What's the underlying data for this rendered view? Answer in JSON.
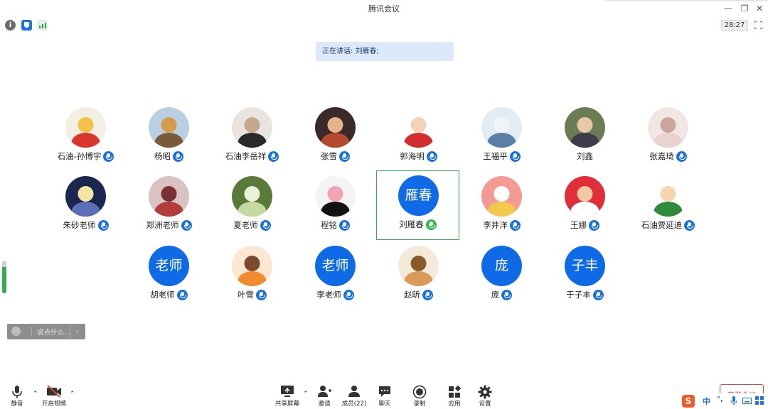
{
  "window": {
    "title": "腾讯会议"
  },
  "toolbar": {
    "timer": "28:27"
  },
  "banner": {
    "speaking": "正在讲话: 刘雁春;"
  },
  "participants": [
    {
      "name": "石油-孙博宇",
      "initials": "",
      "avatar": "photo",
      "mic": "on"
    },
    {
      "name": "杨昭",
      "initials": "",
      "avatar": "photo",
      "mic": "on"
    },
    {
      "name": "石油李岳祥",
      "initials": "",
      "avatar": "photo",
      "mic": "on"
    },
    {
      "name": "张雪",
      "initials": "",
      "avatar": "photo",
      "mic": "on"
    },
    {
      "name": "郭海明",
      "initials": "",
      "avatar": "photo",
      "mic": "on"
    },
    {
      "name": "王福平",
      "initials": "",
      "avatar": "photo",
      "mic": "on"
    },
    {
      "name": "刘鑫",
      "initials": "",
      "avatar": "photo",
      "mic": "none"
    },
    {
      "name": "张嘉琦",
      "initials": "",
      "avatar": "photo",
      "mic": "on"
    },
    {
      "name": "朱砂老师",
      "initials": "",
      "avatar": "photo",
      "mic": "on"
    },
    {
      "name": "郑洲老师",
      "initials": "",
      "avatar": "photo",
      "mic": "on"
    },
    {
      "name": "夏老师",
      "initials": "",
      "avatar": "photo",
      "mic": "on"
    },
    {
      "name": "程铭",
      "initials": "",
      "avatar": "photo",
      "mic": "on"
    },
    {
      "name": "刘雁春",
      "initials": "雁春",
      "avatar": "initials",
      "mic": "talking",
      "active": true
    },
    {
      "name": "李井洋",
      "initials": "",
      "avatar": "photo",
      "mic": "on"
    },
    {
      "name": "王娜",
      "initials": "",
      "avatar": "photo",
      "mic": "on"
    },
    {
      "name": "石油贾延迪",
      "initials": "",
      "avatar": "photo",
      "mic": "on"
    },
    {
      "name": "胡老师",
      "initials": "老师",
      "avatar": "initials",
      "mic": "on"
    },
    {
      "name": "叶雪",
      "initials": "",
      "avatar": "photo",
      "mic": "on"
    },
    {
      "name": "李老师",
      "initials": "老师",
      "avatar": "initials",
      "mic": "on"
    },
    {
      "name": "赵昕",
      "initials": "",
      "avatar": "photo",
      "mic": "on"
    },
    {
      "name": "庞",
      "initials": "庞",
      "avatar": "initials",
      "mic": "on"
    },
    {
      "name": "于子丰",
      "initials": "子丰",
      "avatar": "initials",
      "mic": "on"
    }
  ],
  "chat": {
    "placeholder": "说点什么..."
  },
  "controls": {
    "mute": "静音",
    "video": "开启视频",
    "share": "共享屏幕",
    "invite": "邀请",
    "members": "成员(22)",
    "chat": "聊天",
    "record": "录制",
    "apps": "应用",
    "settings": "设置",
    "end": "离开会议"
  },
  "ime": {
    "lang": "中"
  },
  "colors": {
    "accent": "#0f6ae8",
    "talking": "#2fb94f",
    "danger": "#e0443b"
  }
}
